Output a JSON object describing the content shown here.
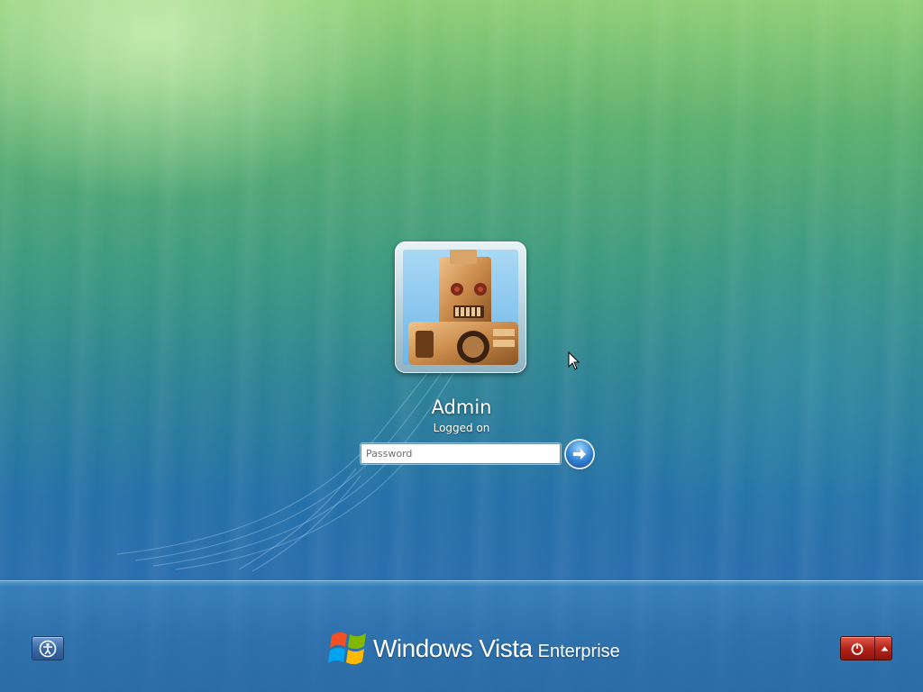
{
  "login": {
    "user_name": "Admin",
    "user_status": "Logged on",
    "user_picture": "robot-avatar",
    "password_placeholder": "Password",
    "password_value": "",
    "submit_icon": "arrow-right-icon"
  },
  "footer": {
    "ease_of_access_icon": "ease-of-access-icon",
    "power_icon": "power-icon",
    "power_menu_icon": "chevron-up-icon",
    "brand_name": "Windows Vista",
    "brand_edition": "Enterprise",
    "brand_logo": "windows-flag-logo"
  },
  "colors": {
    "power_button": "#b3241a",
    "ease_button": "#3b6aa8",
    "submit_button": "#2f7fd1",
    "background_top": "#8fcf78",
    "background_bottom": "#2f6ea8"
  }
}
